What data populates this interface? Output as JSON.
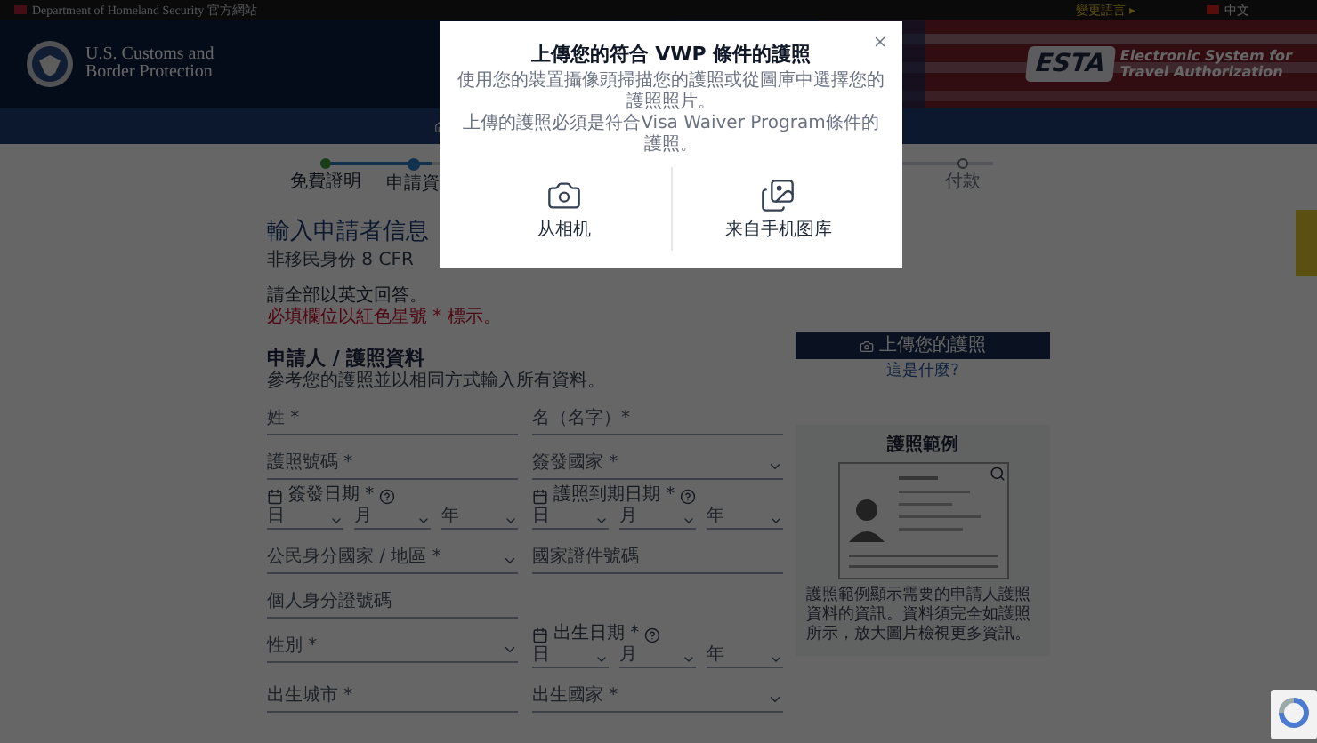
{
  "top_bar": {
    "agency": "Department of Homeland Security 官方網站",
    "change_language": "變更語言 ▸",
    "language": "中文"
  },
  "header": {
    "agency_line1": "U.S. Customs and",
    "agency_line2": "Border Protection",
    "esta_logo": "ESTA",
    "esta_line1": "Electronic System for",
    "esta_line2": "Travel Authorization"
  },
  "progress": {
    "steps": [
      {
        "label": "免費證明",
        "completed": true,
        "selected": false
      },
      {
        "label": "申請資",
        "completed": false,
        "selected": true
      },
      {
        "label": "付款",
        "completed": false,
        "selected": false
      }
    ]
  },
  "page": {
    "title": "輸入申請者信息",
    "intro": "非移民身份 8 CFR",
    "note": "請全部以英文回答。",
    "required_note": "必填欄位以紅色星號 * 標示。"
  },
  "section": {
    "title": "申請人 / 護照資料",
    "hint": "參考您的護照並以相同方式輸入所有資料。"
  },
  "rows": [
    [
      {
        "kind": "text",
        "label": "姓 *"
      },
      {
        "kind": "text",
        "label": "名（名字）*"
      }
    ],
    [
      {
        "kind": "text",
        "label": "護照號碼 *"
      },
      {
        "kind": "select",
        "label": "簽發國家 *"
      }
    ],
    [
      {
        "kind": "date",
        "label": "簽發日期 *",
        "parts": [
          "日",
          "月",
          "年"
        ]
      },
      {
        "kind": "date",
        "label": "護照到期日期 *",
        "parts": [
          "日",
          "月",
          "年"
        ]
      }
    ],
    [
      {
        "kind": "select",
        "label": "公民身分國家 / 地區 *"
      },
      {
        "kind": "text",
        "label": "國家證件號碼"
      }
    ],
    [
      {
        "kind": "text",
        "label": "個人身分證號碼"
      }
    ],
    [
      {
        "kind": "select",
        "label": "性別 *"
      },
      {
        "kind": "date",
        "label": "出生日期 *",
        "parts": [
          "日",
          "月",
          "年"
        ]
      }
    ],
    [
      {
        "kind": "text",
        "label": "出生城市 *"
      },
      {
        "kind": "select",
        "label": "出生國家 *"
      }
    ]
  ],
  "side": {
    "upload_button": "上傳您的護照",
    "help_link": "這是什麼?",
    "sample_title": "護照範例",
    "sample_caption": "護照範例顯示需要的申請人護照資料的資訊。資料須完全如護照所示，放大圖片檢視更多資訊。"
  },
  "modal": {
    "title": "上傳您的符合 VWP 條件的護照",
    "description": [
      "使用您的裝置攝像頭掃描您的護照或從圖庫中選擇您的護照照片。",
      "上傳的護照必須是符合Visa Waiver Program條件的護照。"
    ],
    "options": [
      {
        "kind": "camera",
        "label": "从相机"
      },
      {
        "kind": "gallery",
        "label": "来自手机图库"
      }
    ]
  }
}
